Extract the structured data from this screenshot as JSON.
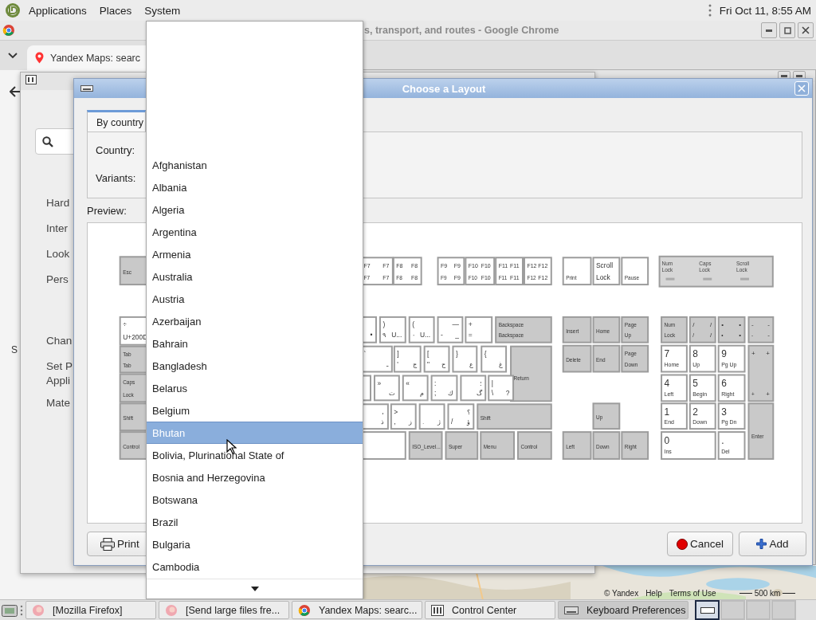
{
  "top_panel": {
    "menus": [
      "Applications",
      "Places",
      "System"
    ],
    "clock": "Fri Oct 11,  8:55 AM"
  },
  "browser": {
    "title": "s, transport, and routes - Google Chrome",
    "tab": "Yandex Maps: searc",
    "side_text": "S",
    "map": {
      "links": [
        "© Yandex",
        "Help",
        "Terms of Use"
      ],
      "scale": "500 km"
    }
  },
  "control_center": {
    "items": [
      "Hard",
      "Inter",
      "Look",
      "Pers",
      "Chan",
      "Set P",
      "Appli",
      "Mate"
    ]
  },
  "dialog": {
    "title": "Choose a Layout",
    "tabs": [
      {
        "label": "By country",
        "selected": true
      }
    ],
    "fields": [
      "Country:",
      "Variants:"
    ],
    "preview_label": "Preview:",
    "lock_indicators": [
      "Num Lock",
      "Caps Lock",
      "Scroll Lock"
    ],
    "keys": [
      {
        "kind": "mod",
        "bl": "Esc"
      },
      {
        "kind": "char",
        "tl": "÷",
        "bl": "U+200D"
      },
      {
        "kind": "mod",
        "tl": "Tab",
        "bl": "Tab"
      },
      {
        "kind": "mod",
        "tl": "Caps",
        "bl": "Lock"
      },
      {
        "kind": "mod",
        "bl": "Shift"
      },
      {
        "kind": "mod",
        "bl": "Control"
      },
      {
        "kind": "char",
        "tl": "F7",
        "tr": "F7",
        "bl": "F7",
        "br": "F7"
      },
      {
        "kind": "char",
        "tl": "F8",
        "tr": "F8",
        "bl": "F8",
        "br": "F8"
      },
      {
        "kind": "char",
        "tl": "F9",
        "tr": "F9",
        "bl": "F9",
        "br": "F9"
      },
      {
        "kind": "char",
        "tl": "F10",
        "tr": "F10",
        "bl": "F10",
        "br": "F10"
      },
      {
        "kind": "char",
        "tl": "F11",
        "tr": "F11",
        "bl": "F11",
        "br": "F11"
      },
      {
        "kind": "char",
        "tl": "F12",
        "tr": "F12",
        "bl": "F12",
        "br": "F12"
      },
      {
        "kind": "char",
        "bl": "Print"
      },
      {
        "kind": "char",
        "tl": "Scroll",
        "bl": "Lock"
      },
      {
        "kind": "char",
        "bl": "Pause"
      },
      {
        "kind": "char",
        "br": "•"
      },
      {
        "kind": "char",
        "tl": ")",
        "bl": "٩",
        "br": "U..."
      },
      {
        "kind": "char",
        "tl": "(",
        "bl": "٠",
        "br": "U..."
      },
      {
        "kind": "char",
        "tr": "—",
        "bl": "-",
        "br": "_"
      },
      {
        "kind": "char",
        "tl": "+",
        "bl": "="
      },
      {
        "kind": "mod",
        "tl": "Backspace",
        "bl": "Backspace"
      },
      {
        "kind": "char",
        "tl": "ˋ",
        "br": "ـ"
      },
      {
        "kind": "char",
        "tl": "]",
        "bl": "'",
        "br": "ج"
      },
      {
        "kind": "char",
        "tl": "[",
        "bl": "\"",
        "br": "ح"
      },
      {
        "kind": "char",
        "tl": "}",
        "br": "ع"
      },
      {
        "kind": "char",
        "tl": "{",
        "br": "غ"
      },
      {
        "kind": "mod",
        "bl": "Return"
      },
      {
        "kind": "char"
      },
      {
        "kind": "char",
        "tl": "»",
        "br": "ت"
      },
      {
        "kind": "char",
        "tl": "«",
        "br": "م"
      },
      {
        "kind": "char",
        "tl": ":",
        "bl": ";",
        "br": "ك"
      },
      {
        "kind": "char",
        "tr": "؛",
        "br": "گ"
      },
      {
        "kind": "char",
        "tl": "|",
        "bl": "\\",
        "br": "?"
      },
      {
        "kind": "char",
        "tr": "،",
        "br": "ذ"
      },
      {
        "kind": "char",
        "tl": ">",
        "bl": ",",
        "br": "ز"
      },
      {
        "kind": "char",
        "bl": ".",
        "br": "ژ"
      },
      {
        "kind": "char",
        "tr": "؟",
        "bl": "/",
        "br": "ؤ"
      },
      {
        "kind": "mod",
        "bl": "Shift"
      },
      {
        "kind": "char"
      },
      {
        "kind": "mod",
        "bl": "ISO_Level..."
      },
      {
        "kind": "mod",
        "bl": "Super"
      },
      {
        "kind": "mod",
        "bl": "Menu"
      },
      {
        "kind": "mod",
        "bl": "Control"
      },
      {
        "kind": "mod",
        "bl": "Insert"
      },
      {
        "kind": "mod",
        "bl": "Home"
      },
      {
        "kind": "mod",
        "tl": "Page",
        "bl": "Up"
      },
      {
        "kind": "mod",
        "bl": "Delete"
      },
      {
        "kind": "mod",
        "bl": "End"
      },
      {
        "kind": "mod",
        "tl": "Page",
        "bl": "Down"
      },
      {
        "kind": "mod",
        "bl": "Up"
      },
      {
        "kind": "mod",
        "bl": "Left"
      },
      {
        "kind": "mod",
        "bl": "Down"
      },
      {
        "kind": "mod",
        "bl": "Right"
      },
      {
        "kind": "mod",
        "tl": "Num",
        "bl": "Lock"
      },
      {
        "kind": "mod",
        "tl": "/",
        "tr": "/",
        "bl": "/",
        "br": "/"
      },
      {
        "kind": "mod",
        "tl": "•",
        "tr": "•",
        "bl": "•",
        "br": "•"
      },
      {
        "kind": "mod",
        "tl": "-",
        "tr": "-",
        "bl": "-",
        "br": "-"
      },
      {
        "kind": "num",
        "tl": "7",
        "bl": "Home"
      },
      {
        "kind": "num",
        "tl": "8",
        "bl": "Up"
      },
      {
        "kind": "num",
        "tl": "9",
        "bl": "Pg Up"
      },
      {
        "kind": "num",
        "tl": "4",
        "bl": "Left"
      },
      {
        "kind": "num",
        "tl": "5",
        "bl": "Begin"
      },
      {
        "kind": "num",
        "tl": "6",
        "bl": "Right"
      },
      {
        "kind": "mod",
        "tl": "+",
        "tr": "+",
        "bl": "+",
        "br": "+"
      },
      {
        "kind": "num",
        "tl": "1",
        "bl": "End"
      },
      {
        "kind": "num",
        "tl": "2",
        "bl": "Down"
      },
      {
        "kind": "num",
        "tl": "3",
        "bl": "Pg Dn"
      },
      {
        "kind": "mod",
        "bl": "Enter"
      },
      {
        "kind": "num",
        "tl": "0",
        "bl": "Ins"
      },
      {
        "kind": "num",
        "tl": ".",
        "bl": "Del"
      }
    ],
    "buttons": [
      {
        "kind": "print",
        "label": "Print"
      },
      {
        "kind": "cancel",
        "label": "Cancel"
      },
      {
        "kind": "add",
        "label": "Add"
      }
    ]
  },
  "dropdown": {
    "items": [
      {
        "label": "Afghanistan",
        "selected": false
      },
      {
        "label": "Albania",
        "selected": false
      },
      {
        "label": "Algeria",
        "selected": false
      },
      {
        "label": "Argentina",
        "selected": false
      },
      {
        "label": "Armenia",
        "selected": false
      },
      {
        "label": "Australia",
        "selected": false
      },
      {
        "label": "Austria",
        "selected": false
      },
      {
        "label": "Azerbaijan",
        "selected": false
      },
      {
        "label": "Bahrain",
        "selected": false
      },
      {
        "label": "Bangladesh",
        "selected": false
      },
      {
        "label": "Belarus",
        "selected": false
      },
      {
        "label": "Belgium",
        "selected": false
      },
      {
        "label": "Bhutan",
        "selected": true
      },
      {
        "label": "Bolivia, Plurinational State of",
        "selected": false
      },
      {
        "label": "Bosnia and Herzegovina",
        "selected": false
      },
      {
        "label": "Botswana",
        "selected": false
      },
      {
        "label": "Brazil",
        "selected": false
      },
      {
        "label": "Bulgaria",
        "selected": false
      },
      {
        "label": "Cambodia",
        "selected": false
      }
    ]
  },
  "taskbar": {
    "tasks": [
      {
        "kind": "firefox",
        "label": "[Mozilla Firefox]",
        "selected": false
      },
      {
        "kind": "firefox",
        "label": "[Send large files fre...",
        "selected": false
      },
      {
        "kind": "chrome",
        "label": "Yandex Maps: searc...",
        "selected": false
      },
      {
        "kind": "control",
        "label": "Control Center",
        "selected": false
      },
      {
        "kind": "keyboard",
        "label": "Keyboard Preferences",
        "selected": true
      }
    ],
    "workspaces": [
      {
        "selected": true
      },
      {
        "selected": false
      },
      {
        "selected": false
      },
      {
        "selected": false
      }
    ]
  }
}
